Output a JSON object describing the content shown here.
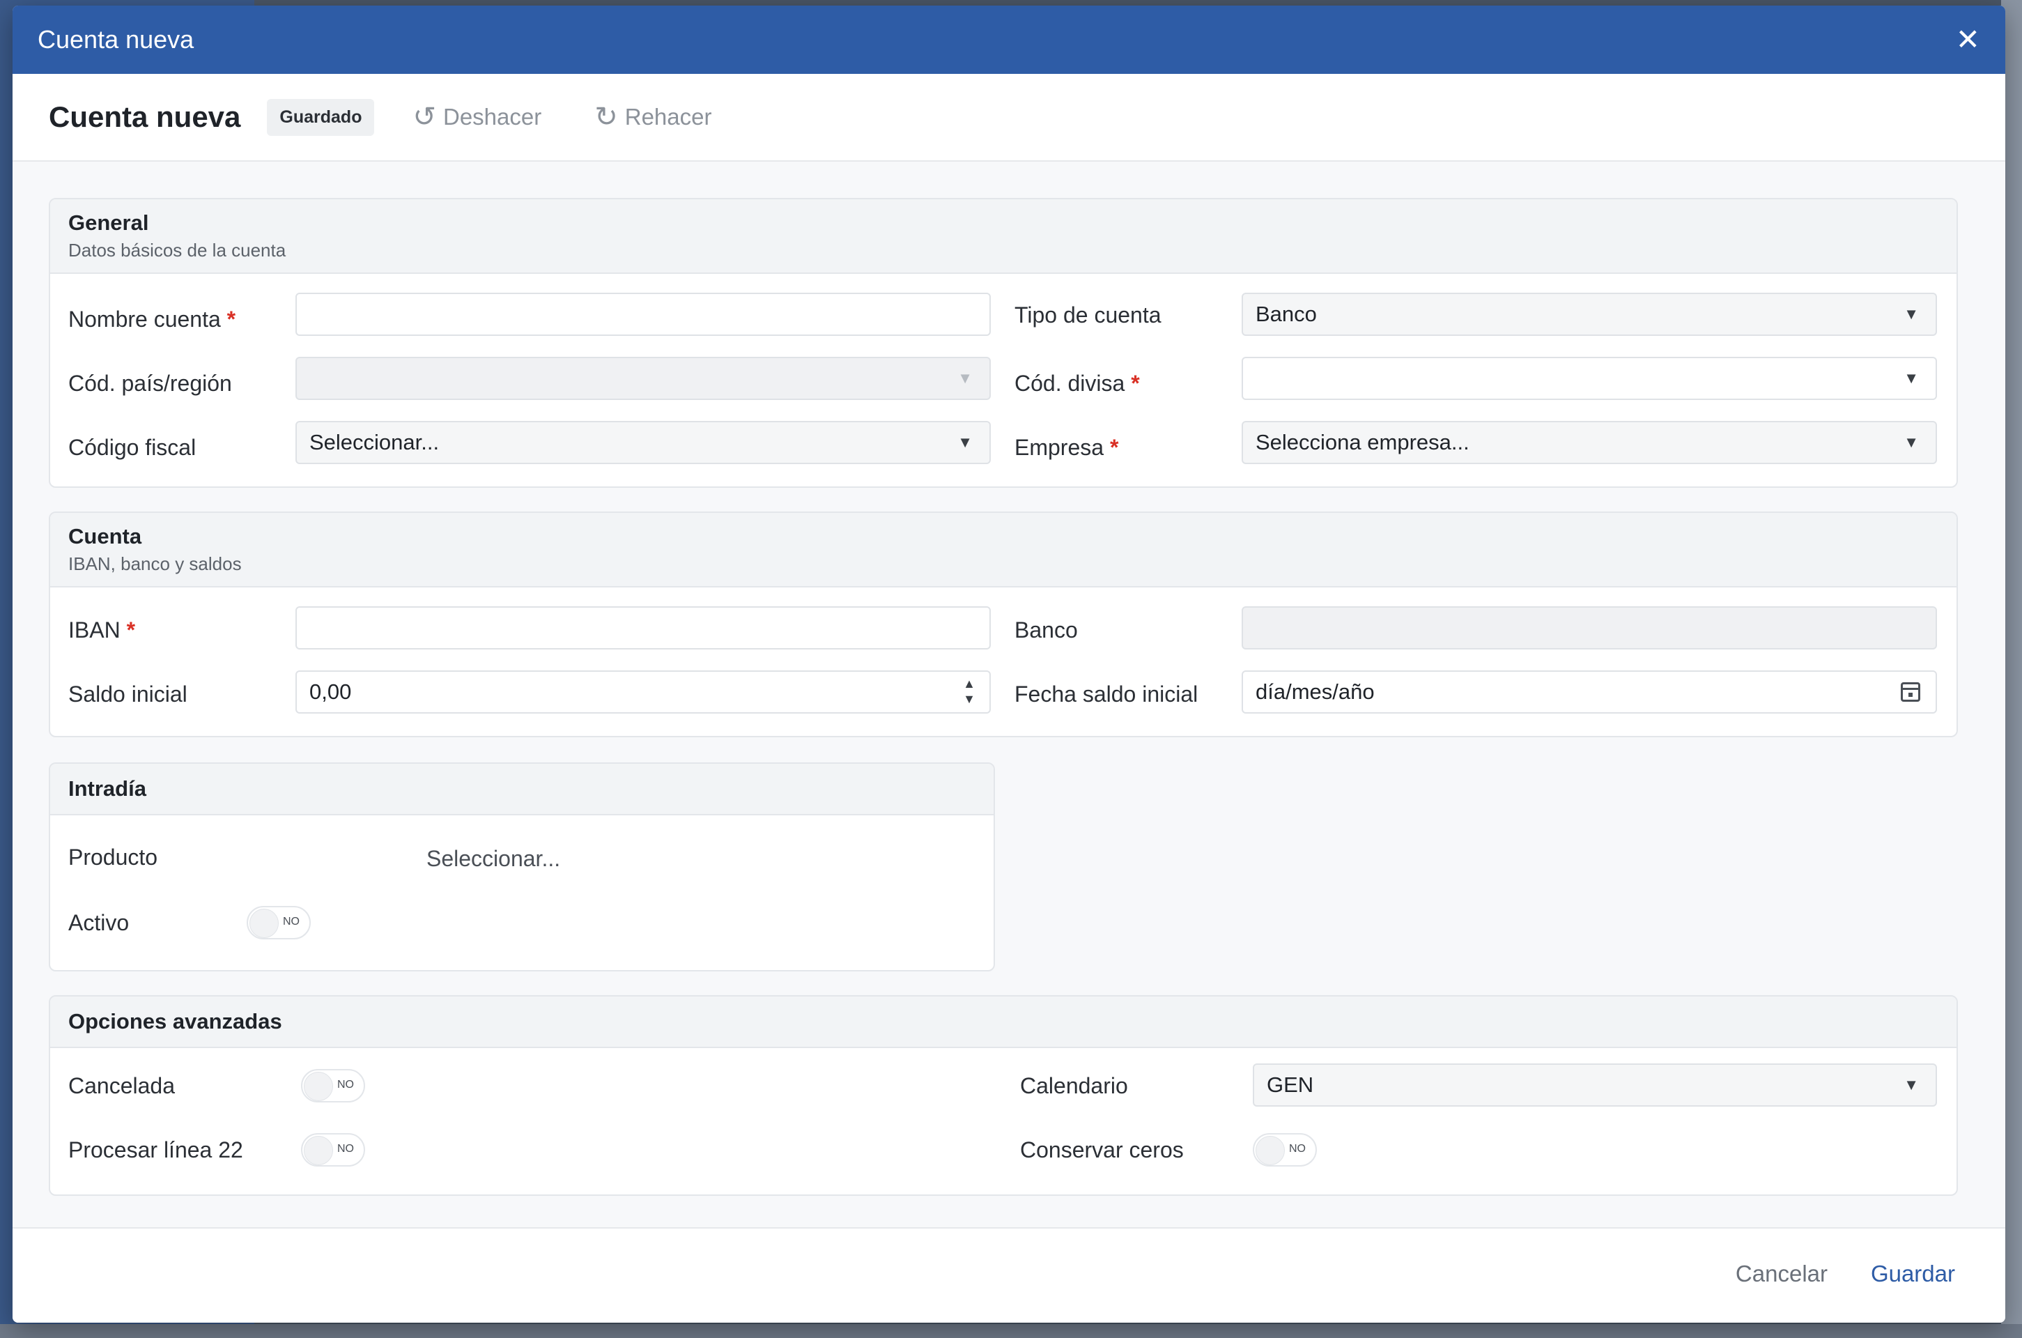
{
  "window": {
    "title": "Cuenta nueva"
  },
  "toolbar": {
    "heading": "Cuenta nueva",
    "status_badge": "Guardado",
    "undo_label": "Deshacer",
    "redo_label": "Rehacer"
  },
  "general": {
    "title": "General",
    "subtitle": "Datos básicos de la cuenta",
    "account_name_label": "Nombre cuenta",
    "account_name_value": "",
    "account_type_label": "Tipo de cuenta",
    "account_type_value": "Banco",
    "country_label": "Cód. país/región",
    "country_value": "",
    "currency_label": "Cód. divisa",
    "currency_value": "",
    "tax_code_label": "Código fiscal",
    "tax_code_value": "Seleccionar...",
    "company_label": "Empresa",
    "company_value": "Selecciona empresa..."
  },
  "cuenta": {
    "title": "Cuenta",
    "subtitle": "IBAN, banco y saldos",
    "iban_label": "IBAN",
    "iban_value": "",
    "bank_label": "Banco",
    "bank_value": "",
    "initial_balance_label": "Saldo inicial",
    "initial_balance_value": "0,00",
    "initial_balance_date_label": "Fecha saldo inicial",
    "initial_balance_date_value": "día/mes/año"
  },
  "intraday": {
    "title": "Intradía",
    "product_label": "Producto",
    "product_value": "Seleccionar...",
    "active_label": "Activo",
    "active_toggle": "NO"
  },
  "advanced": {
    "title": "Opciones avanzadas",
    "cancelled_label": "Cancelada",
    "cancelled_toggle": "NO",
    "line22_label": "Procesar línea 22",
    "line22_toggle": "NO",
    "calendar_label": "Calendario",
    "calendar_value": "GEN",
    "keep_zeros_label": "Conservar ceros",
    "keep_zeros_toggle": "NO"
  },
  "footer": {
    "cancel_label": "Cancelar",
    "save_label": "Guardar"
  },
  "required_marker": "*",
  "colors": {
    "header_blue": "#2e5ca6",
    "required_red": "#d93025"
  }
}
